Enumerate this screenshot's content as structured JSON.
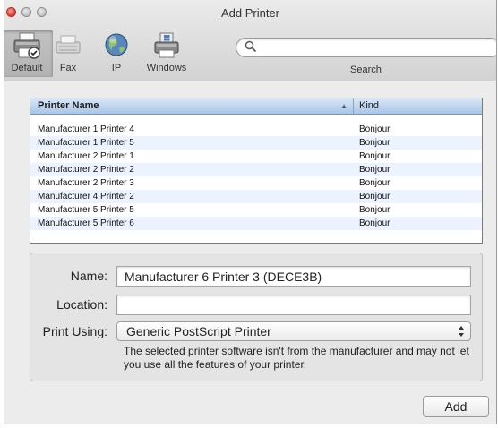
{
  "window": {
    "title": "Add Printer"
  },
  "toolbar": {
    "items": [
      {
        "label": "Default",
        "icon": "default-printer-icon",
        "selected": true
      },
      {
        "label": "Fax",
        "icon": "fax-icon",
        "selected": false
      },
      {
        "label": "IP",
        "icon": "globe-icon",
        "selected": false
      },
      {
        "label": "Windows",
        "icon": "windows-printer-icon",
        "selected": false
      }
    ],
    "search": {
      "value": "",
      "placeholder": "",
      "label": "Search"
    }
  },
  "printer_list": {
    "columns": {
      "name": "Printer Name",
      "kind": "Kind"
    },
    "rows": [
      {
        "name": "Manufacturer 1 Printer 4",
        "kind": "Bonjour"
      },
      {
        "name": "Manufacturer 1 Printer 5",
        "kind": "Bonjour"
      },
      {
        "name": "Manufacturer 2 Printer 1",
        "kind": "Bonjour"
      },
      {
        "name": "Manufacturer 2 Printer 2",
        "kind": "Bonjour"
      },
      {
        "name": "Manufacturer 2 Printer 3",
        "kind": "Bonjour"
      },
      {
        "name": "Manufacturer 4 Printer 2",
        "kind": "Bonjour"
      },
      {
        "name": "Manufacturer 5 Printer 5",
        "kind": "Bonjour"
      },
      {
        "name": "Manufacturer 5 Printer 6",
        "kind": "Bonjour"
      }
    ]
  },
  "details": {
    "name_label": "Name:",
    "name_value": "Manufacturer 6 Printer 3 (DECE3B)",
    "location_label": "Location:",
    "location_value": "",
    "print_using_label": "Print Using:",
    "print_using_value": "Generic PostScript Printer",
    "note": "The selected printer software isn't from the manufacturer and may not let you use all the features of your printer."
  },
  "buttons": {
    "add": "Add"
  }
}
